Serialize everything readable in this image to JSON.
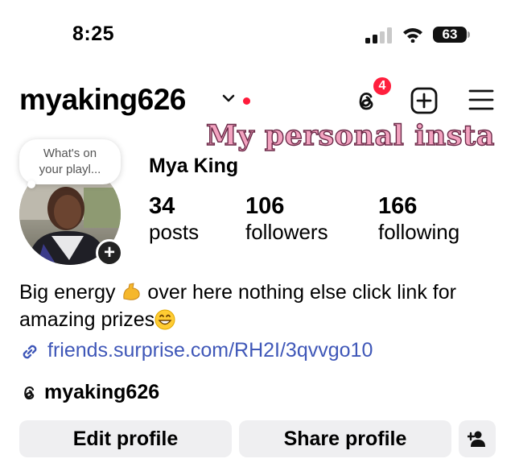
{
  "status_bar": {
    "time": "8:25",
    "battery": "63"
  },
  "header": {
    "username": "myaking626",
    "notification_count": "4"
  },
  "overlay_text": "My personal insta",
  "note": {
    "line1": "What's on",
    "line2": "your playl..."
  },
  "profile": {
    "display_name": "Mya King",
    "stats": [
      {
        "value": "34",
        "label": "posts"
      },
      {
        "value": "106",
        "label": "followers"
      },
      {
        "value": "166",
        "label": "following"
      }
    ],
    "bio_part1": "Big energy ",
    "bio_part2": " over here nothing else click link for amazing prizes",
    "link": "friends.surprise.com/RH2I/3qvvgo10",
    "threads_handle": "myaking626"
  },
  "buttons": {
    "edit": "Edit profile",
    "share": "Share profile"
  },
  "colors": {
    "badge": "#ff1f3d",
    "link": "#3f57b8",
    "button_bg": "#efeff1"
  }
}
